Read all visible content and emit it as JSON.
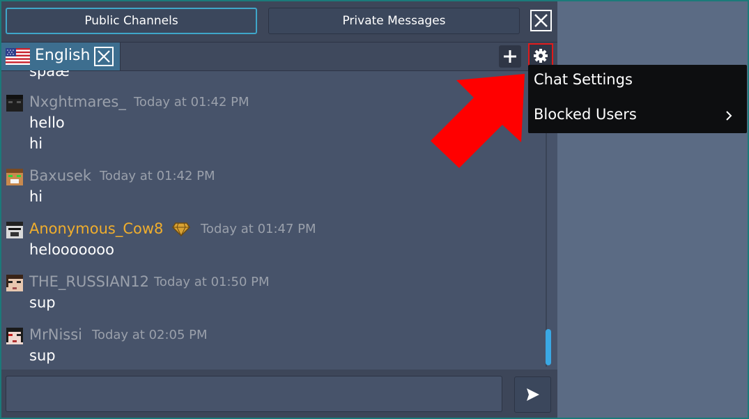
{
  "tabs": {
    "public": "Public Channels",
    "private": "Private Messages"
  },
  "channel": {
    "name": "English"
  },
  "messages": {
    "partial_text": "spaæ",
    "groups": [
      {
        "username": "Nxghtmares_",
        "timestamp": "Today at 01:42 PM",
        "lines": [
          "hello",
          "hi"
        ]
      },
      {
        "username": "Baxusek",
        "timestamp": "Today at 01:42 PM",
        "lines": [
          "hi"
        ]
      },
      {
        "username": "Anonymous_Cow8",
        "timestamp": "Today at 01:47 PM",
        "lines": [
          "helooooooo"
        ],
        "badge": "gem-badge-icon"
      },
      {
        "username": "THE_RUSSIAN12",
        "timestamp": "Today at 01:50 PM",
        "lines": [
          "sup"
        ]
      },
      {
        "username": "MrNissi",
        "timestamp": "Today at 02:05 PM",
        "lines": [
          "sup"
        ]
      }
    ]
  },
  "input": {
    "value": ""
  },
  "menu": {
    "items": [
      {
        "label": "Chat Settings"
      },
      {
        "label": "Blocked Users"
      }
    ]
  },
  "colors": {
    "accent": "#3fa6c9",
    "highlight": "#e01a1a",
    "special_username": "#f0ae2d",
    "scroll_thumb": "#3aa8e4"
  },
  "icons": {
    "close": "close-icon",
    "add": "plus-icon",
    "settings": "gear-icon",
    "send": "send-icon",
    "flag": "us-flag-icon",
    "submenu": "chevron-right-icon",
    "pointer": "red-arrow-icon"
  }
}
